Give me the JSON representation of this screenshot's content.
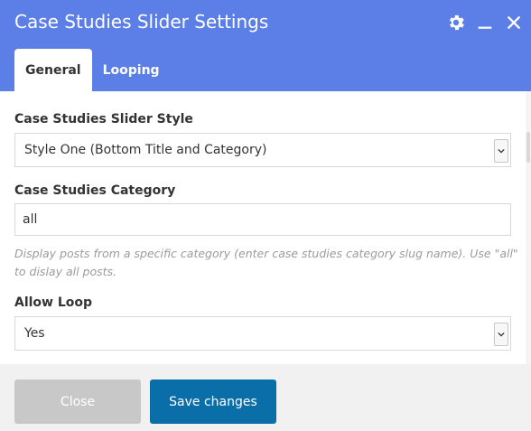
{
  "dialog": {
    "title": "Case Studies Slider Settings",
    "tabs": [
      {
        "label": "General"
      },
      {
        "label": "Looping"
      }
    ],
    "fields": {
      "slider_style": {
        "label": "Case Studies Slider Style",
        "value": "Style One (Bottom Title and Category)"
      },
      "category": {
        "label": "Case Studies Category",
        "value": "all",
        "hint": "Display posts from a specific category (enter case studies category slug name). Use \"all\" to dislay all posts."
      },
      "allow_loop": {
        "label": "Allow Loop",
        "value": "Yes"
      }
    },
    "buttons": {
      "close": "Close",
      "save": "Save changes"
    }
  },
  "colors": {
    "header": "#5b7fe6",
    "save": "#0a6ea9",
    "close": "#c8c8c8"
  }
}
